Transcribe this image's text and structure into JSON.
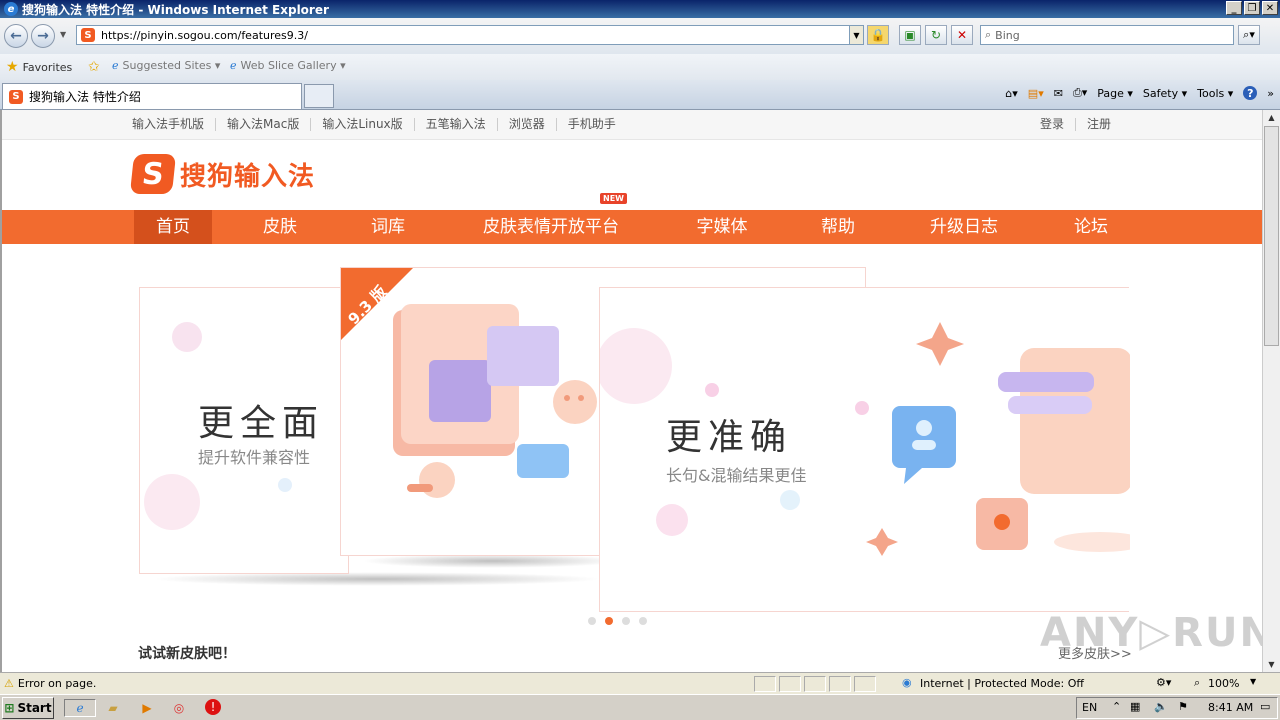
{
  "window": {
    "title": "搜狗输入法 特性介绍 - Windows Internet Explorer",
    "controls": [
      "_",
      "❐",
      "✕"
    ]
  },
  "address": {
    "url": "https://pinyin.sogou.com/features9.3/",
    "search_placeholder": "Bing"
  },
  "favorites": {
    "label": "Favorites",
    "suggested": "Suggested Sites ▾",
    "webslice": "Web Slice Gallery ▾"
  },
  "tab": {
    "title": "搜狗输入法 特性介绍"
  },
  "commandbar": {
    "page": "Page ▾",
    "safety": "Safety ▾",
    "tools": "Tools ▾",
    "help": "?"
  },
  "site": {
    "toplinks": [
      "输入法手机版",
      "输入法Mac版",
      "输入法Linux版",
      "五笔输入法",
      "浏览器",
      "手机助手"
    ],
    "auth": [
      "登录",
      "注册"
    ],
    "logo_text": "搜狗输入法",
    "logo_mark": "S",
    "nav": [
      "首页",
      "皮肤",
      "词库",
      "皮肤表情开放平台",
      "字媒体",
      "帮助",
      "升级日志",
      "论坛"
    ],
    "new_badge": "NEW",
    "version_ribbon": "9.3 版",
    "slides": [
      {
        "title": "更全面",
        "sub": "提升软件兼容性"
      },
      {
        "title": "更准确",
        "sub": "长句&混输结果更佳"
      }
    ],
    "skin_heading": "试试新皮肤吧！",
    "more_skins": "更多皮肤>>",
    "watermark": "ANY▷RUN"
  },
  "status": {
    "text": "Error on page.",
    "zone": "Internet | Protected Mode: Off",
    "zoom": "100%"
  },
  "taskbar": {
    "start": "Start",
    "lang": "EN",
    "clock": "8:41 AM"
  },
  "colors": {
    "accent": "#f26b2f",
    "nav_active": "#d4501c",
    "logo": "#f15a22"
  }
}
